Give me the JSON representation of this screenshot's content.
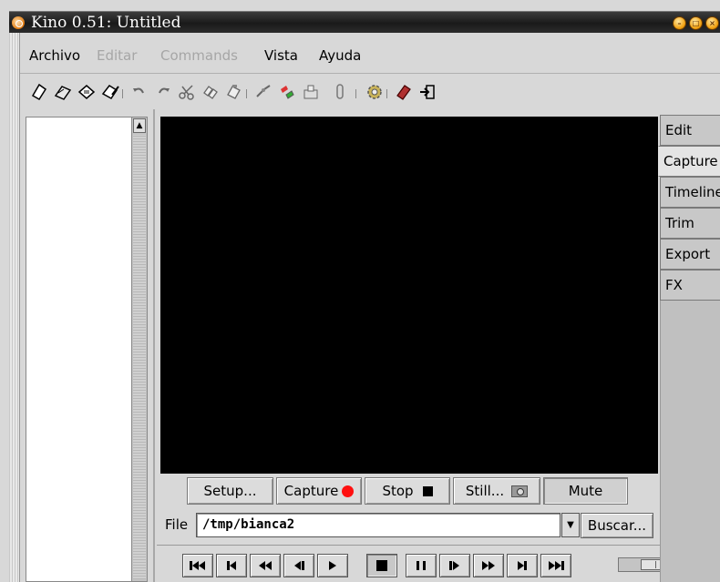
{
  "window": {
    "title": "Kino 0.51: Untitled"
  },
  "menubar": {
    "items": [
      {
        "label": "Archivo",
        "enabled": true
      },
      {
        "label": "Editar",
        "enabled": false
      },
      {
        "label": "Commands",
        "enabled": false
      },
      {
        "label": "Vista",
        "enabled": true
      },
      {
        "label": "Ayuda",
        "enabled": true
      }
    ]
  },
  "toolbar": {
    "icons": [
      "new-icon",
      "open-icon",
      "save-icon",
      "save-as-icon",
      "undo-icon",
      "redo-icon",
      "cut-icon",
      "copy-icon",
      "paste-icon",
      "split-icon",
      "join-icon",
      "insert-icon",
      "clip-icon",
      "preferences-icon",
      "help-book-icon",
      "exit-icon"
    ]
  },
  "capture": {
    "setup_label": "Setup...",
    "capture_label": "Capture",
    "stop_label": "Stop",
    "still_label": "Still...",
    "mute_label": "Mute",
    "record_color": "#ff1010"
  },
  "file": {
    "label": "File",
    "value": "/tmp/bianca2",
    "browse_label": "Buscar..."
  },
  "transport": {
    "buttons": [
      "first-frame-icon",
      "previous-scene-icon",
      "rewind-icon",
      "previous-frame-icon",
      "play-icon",
      "stop-icon",
      "pause-icon",
      "next-frame-icon",
      "fast-forward-icon",
      "next-scene-icon",
      "last-frame-icon"
    ]
  },
  "tabs": [
    {
      "label": "Edit",
      "active": false
    },
    {
      "label": "Capture",
      "active": true
    },
    {
      "label": "Timeline",
      "active": false
    },
    {
      "label": "Trim",
      "active": false
    },
    {
      "label": "Export",
      "active": false
    },
    {
      "label": "FX",
      "active": false
    }
  ]
}
